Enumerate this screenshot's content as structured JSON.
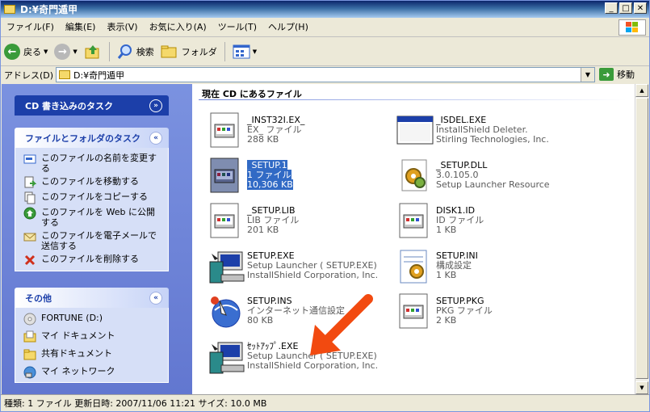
{
  "window": {
    "title": "D:¥奇門遁甲"
  },
  "menu": [
    "ファイル(F)",
    "編集(E)",
    "表示(V)",
    "お気に入り(A)",
    "ツール(T)",
    "ヘルプ(H)"
  ],
  "toolbar": {
    "back_label": "戻る",
    "search_label": "検索",
    "folders_label": "フォルダ"
  },
  "address": {
    "label": "アドレス(D)",
    "value": "D:¥奇門遁甲",
    "go_label": "移動"
  },
  "panels": {
    "cd": {
      "title": "CD 書き込みのタスク"
    },
    "file_tasks": {
      "title": "ファイルとフォルダのタスク",
      "items": [
        "このファイルの名前を変更する",
        "このファイルを移動する",
        "このファイルをコピーする",
        "このファイルを Web に公開する",
        "このファイルを電子メールで送信する",
        "このファイルを削除する"
      ]
    },
    "other": {
      "title": "その他",
      "items": [
        "FORTUNE (D:)",
        "マイ ドキュメント",
        "共有ドキュメント",
        "マイ ネットワーク"
      ]
    }
  },
  "content": {
    "header": "現在 CD にあるファイル",
    "files": [
      {
        "name": "_INST32I.EX_",
        "type": "EX_ ファイル",
        "info": "288 KB",
        "icon": "generic-file-icon"
      },
      {
        "name": "_ISDEL.EXE",
        "type": "InstallShield Deleter.",
        "info": "Stirling Technologies, Inc.",
        "icon": "app-window-icon"
      },
      {
        "name": "_SETUP.1",
        "type": "1 ファイル",
        "info": "10,306 KB",
        "icon": "generic-file-icon"
      },
      {
        "name": "_SETUP.DLL",
        "type": "3.0.105.0",
        "info": "Setup Launcher Resource",
        "icon": "dll-gear-icon"
      },
      {
        "name": "_SETUP.LIB",
        "type": "LIB ファイル",
        "info": "201 KB",
        "icon": "generic-file-icon"
      },
      {
        "name": "DISK1.ID",
        "type": "ID ファイル",
        "info": "1 KB",
        "icon": "generic-file-icon"
      },
      {
        "name": "SETUP.EXE",
        "type": "Setup Launcher ( SETUP.EXE)",
        "info": "InstallShield Corporation, Inc.",
        "icon": "setup-computer-icon"
      },
      {
        "name": "SETUP.INI",
        "type": "構成設定",
        "info": "1 KB",
        "icon": "ini-gear-icon"
      },
      {
        "name": "SETUP.INS",
        "type": "インターネット通信設定",
        "info": "80 KB",
        "icon": "internet-settings-icon"
      },
      {
        "name": "SETUP.PKG",
        "type": "PKG ファイル",
        "info": "2 KB",
        "icon": "generic-file-icon"
      },
      {
        "name": "ｾｯﾄｱｯﾌﾟ.EXE",
        "type": "Setup Launcher ( SETUP.EXE)",
        "info": "InstallShield Corporation, Inc.",
        "icon": "setup-computer-icon"
      }
    ]
  },
  "status": "種類: 1 ファイル 更新日時: 2007/11/06 11:21 サイズ: 10.0 MB",
  "colors": {
    "accent_arrow": "#f24a10",
    "selection": "#316ac5",
    "pane_blue": "#6f86da"
  }
}
